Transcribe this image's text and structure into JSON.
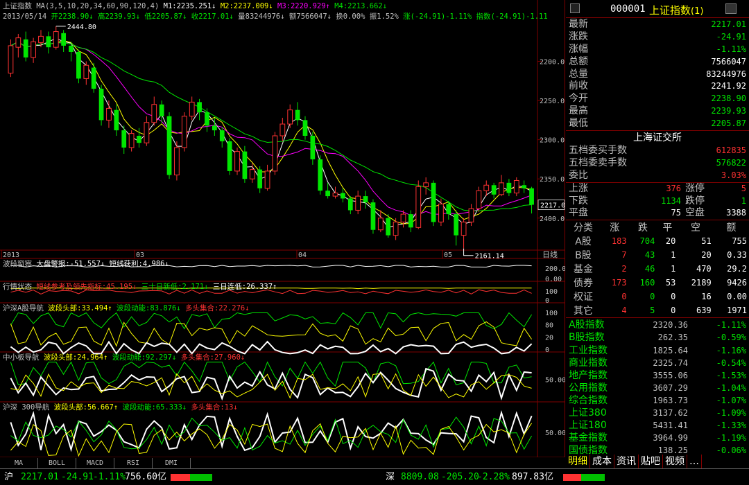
{
  "header": {
    "line1_parts": [
      {
        "text": "上证指数",
        "color": "#c0c0c0"
      },
      {
        "text": " MA(3,5,10,20,34,60,90,120,4)",
        "color": "#c0c0c0"
      },
      {
        "text": " M1:2235.251↓",
        "color": "#ffffff"
      },
      {
        "text": " M2:2237.009↓",
        "color": "#ffff00"
      },
      {
        "text": " M3:2220.929↑",
        "color": "#ff00ff"
      },
      {
        "text": " M4:2213.662↓",
        "color": "#00e600"
      }
    ],
    "line2_parts": [
      {
        "text": "2013/05/14",
        "color": "#c0c0c0"
      },
      {
        "text": " 开2238.90↓",
        "color": "#00e600"
      },
      {
        "text": " 高2239.93↓",
        "color": "#00e600"
      },
      {
        "text": " 低2205.87↓",
        "color": "#00e600"
      },
      {
        "text": " 收2217.01↓",
        "color": "#00e600"
      },
      {
        "text": " 量83244976↓",
        "color": "#c0c0c0"
      },
      {
        "text": " 额7566047↓",
        "color": "#c0c0c0"
      },
      {
        "text": " 换0.00%",
        "color": "#c0c0c0"
      },
      {
        "text": " 振1.52%",
        "color": "#c0c0c0"
      },
      {
        "text": " 涨(-24.91)-1.11%",
        "color": "#00e600"
      },
      {
        "text": " 指数(-24.91)-1.11",
        "color": "#00e600"
      }
    ],
    "high_label": "2444.80",
    "low_label": "2161.14",
    "price_tag": "2217.01"
  },
  "axis": {
    "y_ticks": [
      "2400.0",
      "2350.0",
      "2300.0",
      "2250.0",
      "2200.0"
    ],
    "months": [
      "2013",
      "03",
      "04",
      "05"
    ],
    "period": "日线"
  },
  "panels": [
    {
      "parts": [
        {
          "text": "波段窗察",
          "color": "#c0c0c0"
        },
        {
          "text": " 大盘警报:-51.557↓",
          "color": "#ffffff"
        },
        {
          "text": " 短线获利:4.986↓",
          "color": "#ffffff"
        }
      ],
      "ticks": [
        "200.00",
        "0.00"
      ]
    },
    {
      "parts": [
        {
          "text": "行情状态",
          "color": "#c0c0c0"
        },
        {
          "text": " 短线参考及领先指标:45.195↓",
          "color": "#ff3232"
        },
        {
          "text": " 三十日新低:2.171↓",
          "color": "#00e600"
        },
        {
          "text": " 三日连低:26.337↑",
          "color": "#ffffff"
        }
      ],
      "ticks": [
        "100",
        "0"
      ]
    },
    {
      "parts": [
        {
          "text": "沪深A股导航",
          "color": "#c0c0c0"
        },
        {
          "text": " 波段头部:33.494↑",
          "color": "#ffff00"
        },
        {
          "text": " 波段动能:83.876↓",
          "color": "#00e600"
        },
        {
          "text": " 多头集合:22.276↓",
          "color": "#ff3232"
        }
      ],
      "ticks": [
        "100",
        "80",
        "20",
        "0"
      ]
    },
    {
      "parts": [
        {
          "text": "中小板导航",
          "color": "#c0c0c0"
        },
        {
          "text": " 波段头部:24.964↑",
          "color": "#ffff00"
        },
        {
          "text": " 波段动能:92.297↓",
          "color": "#00e600"
        },
        {
          "text": " 多头集合:27.960↓",
          "color": "#ff3232"
        }
      ],
      "ticks": [
        "50.00"
      ]
    },
    {
      "parts": [
        {
          "text": "沪深 300导航",
          "color": "#c0c0c0"
        },
        {
          "text": " 波段头部:56.667↑",
          "color": "#ffff00"
        },
        {
          "text": " 波段动能:65.333↓",
          "color": "#00e600"
        },
        {
          "text": " 多头集合:13↓",
          "color": "#ff3232"
        }
      ],
      "ticks": [
        "50.00"
      ]
    }
  ],
  "bottom_tabs": [
    "MA",
    "BOLL",
    "MACD",
    "RSI",
    "DMI"
  ],
  "quote": {
    "code": "000001",
    "name": "上证指数",
    "suffix": "(1)",
    "rows": [
      {
        "k": "最新",
        "v": "2217.01",
        "c": "#00e600"
      },
      {
        "k": "涨跌",
        "v": "-24.91",
        "c": "#00e600"
      },
      {
        "k": "涨幅",
        "v": "-1.11%",
        "c": "#00e600"
      },
      {
        "k": "总额",
        "v": "7566047",
        "c": "#ffffff"
      },
      {
        "k": "总量",
        "v": "83244976",
        "c": "#ffffff"
      },
      {
        "k": "前收",
        "v": "2241.92",
        "c": "#ffffff"
      },
      {
        "k": "今开",
        "v": "2238.90",
        "c": "#00e600"
      },
      {
        "k": "最高",
        "v": "2239.93",
        "c": "#00e600"
      },
      {
        "k": "最低",
        "v": "2205.87",
        "c": "#00e600"
      }
    ],
    "exchange": "上海证交所",
    "order_rows": [
      {
        "k": "五档委买手数",
        "v": "612835",
        "c": "#ff3232"
      },
      {
        "k": "五档委卖手数",
        "v": "576822",
        "c": "#00e600"
      },
      {
        "k": "委比",
        "v": "3.03%",
        "c": "#ff3232"
      }
    ],
    "updown": [
      {
        "k1": "上涨",
        "v1": "376",
        "c1": "#ff3232",
        "k2": "涨停",
        "v2": "5",
        "c2": "#ff3232"
      },
      {
        "k1": "下跌",
        "v1": "1134",
        "c1": "#00e600",
        "k2": "跌停",
        "v2": "1",
        "c2": "#00e600"
      },
      {
        "k1": "平盘",
        "v1": "75",
        "c1": "#ffffff",
        "k2": "空盘",
        "v2": "3388",
        "c2": "#ffffff"
      }
    ]
  },
  "market_table": {
    "headers": [
      "分类",
      "涨",
      "跌",
      "平",
      "空",
      "额"
    ],
    "rows": [
      {
        "name": "A股",
        "up": "183",
        "down": "704",
        "flat": "20",
        "empty": "51",
        "amt": "755"
      },
      {
        "name": "B股",
        "up": "7",
        "down": "43",
        "flat": "1",
        "empty": "20",
        "amt": "0.33"
      },
      {
        "name": "基金",
        "up": "2",
        "down": "46",
        "flat": "1",
        "empty": "470",
        "amt": "29.2"
      },
      {
        "name": "债券",
        "up": "173",
        "down": "160",
        "flat": "53",
        "empty": "2189",
        "amt": "9426"
      },
      {
        "name": "权证",
        "up": "0",
        "down": "0",
        "flat": "0",
        "empty": "16",
        "amt": "0.00"
      },
      {
        "name": "其它",
        "up": "4",
        "down": "5",
        "flat": "0",
        "empty": "639",
        "amt": "1971"
      }
    ]
  },
  "indices": [
    {
      "name": "A股指数",
      "price": "2320.36",
      "chg": "-1.11%"
    },
    {
      "name": "B股指数",
      "price": "262.35",
      "chg": "-0.59%"
    },
    {
      "name": "工业指数",
      "price": "1825.64",
      "chg": "-1.16%"
    },
    {
      "name": "商业指数",
      "price": "2325.74",
      "chg": "-0.54%"
    },
    {
      "name": "地产指数",
      "price": "3555.06",
      "chg": "-1.53%"
    },
    {
      "name": "公用指数",
      "price": "3607.29",
      "chg": "-1.04%"
    },
    {
      "name": "综合指数",
      "price": "1963.73",
      "chg": "-1.07%"
    },
    {
      "name": "上证380",
      "price": "3137.62",
      "chg": "-1.09%"
    },
    {
      "name": "上证180",
      "price": "5431.41",
      "chg": "-1.33%"
    },
    {
      "name": "基金指数",
      "price": "3964.99",
      "chg": "-1.19%"
    },
    {
      "name": "国债指数",
      "price": "138.25",
      "chg": "-0.06%"
    }
  ],
  "right_tabs": [
    "明细",
    "成本",
    "资讯",
    "贴吧",
    "视频",
    "…"
  ],
  "status": {
    "sh_label": "沪",
    "sh_price": "2217.01",
    "sh_chg": "-24.91",
    "sh_pct": "-1.11%",
    "sh_amt": "756.60亿",
    "sz_label": "深",
    "sz_price": "8809.08",
    "sz_chg": "-205.20",
    "sz_pct": "-2.28%",
    "sz_amt": "897.83亿"
  },
  "chart_data": {
    "type": "candlestick",
    "title": "上证指数",
    "ylim": [
      2160,
      2450
    ],
    "y_ticks": [
      2200,
      2250,
      2300,
      2350,
      2400
    ],
    "x_month_labels": [
      "2013",
      "03",
      "04",
      "05"
    ],
    "high_point": 2444.8,
    "low_point": 2161.14,
    "last_close": 2217.01,
    "candles": [
      {
        "o": 2385,
        "c": 2420,
        "h": 2428,
        "l": 2380
      },
      {
        "o": 2418,
        "c": 2430,
        "h": 2435,
        "l": 2405
      },
      {
        "o": 2428,
        "c": 2405,
        "h": 2438,
        "l": 2400
      },
      {
        "o": 2405,
        "c": 2425,
        "h": 2430,
        "l": 2398
      },
      {
        "o": 2424,
        "c": 2432,
        "h": 2440,
        "l": 2418
      },
      {
        "o": 2432,
        "c": 2418,
        "h": 2438,
        "l": 2410
      },
      {
        "o": 2418,
        "c": 2438,
        "h": 2444.8,
        "l": 2415
      },
      {
        "o": 2436,
        "c": 2420,
        "h": 2440,
        "l": 2412
      },
      {
        "o": 2420,
        "c": 2412,
        "h": 2425,
        "l": 2400
      },
      {
        "o": 2412,
        "c": 2378,
        "h": 2415,
        "l": 2372
      },
      {
        "o": 2378,
        "c": 2395,
        "h": 2400,
        "l": 2370
      },
      {
        "o": 2392,
        "c": 2365,
        "h": 2398,
        "l": 2360
      },
      {
        "o": 2365,
        "c": 2325,
        "h": 2370,
        "l": 2318
      },
      {
        "o": 2325,
        "c": 2340,
        "h": 2350,
        "l": 2315
      },
      {
        "o": 2338,
        "c": 2312,
        "h": 2345,
        "l": 2305
      },
      {
        "o": 2312,
        "c": 2290,
        "h": 2318,
        "l": 2282
      },
      {
        "o": 2290,
        "c": 2308,
        "h": 2312,
        "l": 2285
      },
      {
        "o": 2305,
        "c": 2296,
        "h": 2315,
        "l": 2290
      },
      {
        "o": 2296,
        "c": 2322,
        "h": 2330,
        "l": 2292
      },
      {
        "o": 2322,
        "c": 2345,
        "h": 2355,
        "l": 2318
      },
      {
        "o": 2345,
        "c": 2330,
        "h": 2350,
        "l": 2322
      },
      {
        "o": 2330,
        "c": 2255,
        "h": 2335,
        "l": 2250
      },
      {
        "o": 2255,
        "c": 2290,
        "h": 2298,
        "l": 2248
      },
      {
        "o": 2290,
        "c": 2330,
        "h": 2335,
        "l": 2285
      },
      {
        "o": 2330,
        "c": 2348,
        "h": 2355,
        "l": 2325
      },
      {
        "o": 2348,
        "c": 2335,
        "h": 2352,
        "l": 2325
      },
      {
        "o": 2335,
        "c": 2318,
        "h": 2340,
        "l": 2310
      },
      {
        "o": 2318,
        "c": 2312,
        "h": 2328,
        "l": 2305
      },
      {
        "o": 2312,
        "c": 2298,
        "h": 2316,
        "l": 2290
      },
      {
        "o": 2298,
        "c": 2260,
        "h": 2302,
        "l": 2255
      },
      {
        "o": 2260,
        "c": 2285,
        "h": 2290,
        "l": 2255
      },
      {
        "o": 2285,
        "c": 2250,
        "h": 2292,
        "l": 2245
      },
      {
        "o": 2250,
        "c": 2262,
        "h": 2270,
        "l": 2245
      },
      {
        "o": 2262,
        "c": 2238,
        "h": 2266,
        "l": 2232
      },
      {
        "o": 2238,
        "c": 2260,
        "h": 2268,
        "l": 2235
      },
      {
        "o": 2260,
        "c": 2305,
        "h": 2310,
        "l": 2255
      },
      {
        "o": 2305,
        "c": 2320,
        "h": 2328,
        "l": 2298
      },
      {
        "o": 2320,
        "c": 2338,
        "h": 2345,
        "l": 2315
      },
      {
        "o": 2338,
        "c": 2325,
        "h": 2348,
        "l": 2318
      },
      {
        "o": 2325,
        "c": 2305,
        "h": 2330,
        "l": 2300
      },
      {
        "o": 2305,
        "c": 2275,
        "h": 2310,
        "l": 2268
      },
      {
        "o": 2275,
        "c": 2235,
        "h": 2280,
        "l": 2230
      },
      {
        "o": 2235,
        "c": 2228,
        "h": 2245,
        "l": 2225
      },
      {
        "o": 2228,
        "c": 2232,
        "h": 2240,
        "l": 2225
      },
      {
        "o": 2232,
        "c": 2225,
        "h": 2238,
        "l": 2220
      },
      {
        "o": 2225,
        "c": 2210,
        "h": 2228,
        "l": 2205
      },
      {
        "o": 2210,
        "c": 2228,
        "h": 2235,
        "l": 2205
      },
      {
        "o": 2228,
        "c": 2220,
        "h": 2235,
        "l": 2212
      },
      {
        "o": 2220,
        "c": 2185,
        "h": 2224,
        "l": 2180
      },
      {
        "o": 2185,
        "c": 2200,
        "h": 2210,
        "l": 2182
      },
      {
        "o": 2200,
        "c": 2178,
        "h": 2205,
        "l": 2175
      },
      {
        "o": 2178,
        "c": 2195,
        "h": 2200,
        "l": 2172
      },
      {
        "o": 2195,
        "c": 2205,
        "h": 2210,
        "l": 2188
      },
      {
        "o": 2205,
        "c": 2188,
        "h": 2210,
        "l": 2182
      },
      {
        "o": 2188,
        "c": 2240,
        "h": 2248,
        "l": 2186
      },
      {
        "o": 2240,
        "c": 2245,
        "h": 2252,
        "l": 2230
      },
      {
        "o": 2245,
        "c": 2195,
        "h": 2248,
        "l": 2190
      },
      {
        "o": 2195,
        "c": 2218,
        "h": 2225,
        "l": 2190
      },
      {
        "o": 2218,
        "c": 2205,
        "h": 2222,
        "l": 2198
      },
      {
        "o": 2205,
        "c": 2178,
        "h": 2210,
        "l": 2165
      },
      {
        "o": 2178,
        "c": 2195,
        "h": 2200,
        "l": 2161.14
      },
      {
        "o": 2195,
        "c": 2212,
        "h": 2218,
        "l": 2190
      },
      {
        "o": 2212,
        "c": 2235,
        "h": 2240,
        "l": 2208
      },
      {
        "o": 2235,
        "c": 2242,
        "h": 2248,
        "l": 2228
      },
      {
        "o": 2242,
        "c": 2230,
        "h": 2245,
        "l": 2225
      },
      {
        "o": 2230,
        "c": 2245,
        "h": 2255,
        "l": 2228
      },
      {
        "o": 2245,
        "c": 2232,
        "h": 2250,
        "l": 2228
      },
      {
        "o": 2232,
        "c": 2248,
        "h": 2252,
        "l": 2228
      },
      {
        "o": 2242,
        "c": 2238,
        "h": 2248,
        "l": 2232
      },
      {
        "o": 2238,
        "c": 2217.01,
        "h": 2239.93,
        "l": 2205.87
      }
    ],
    "ma_series": [
      {
        "name": "M1",
        "color": "#ffffff",
        "period": 3
      },
      {
        "name": "M2",
        "color": "#ffff00",
        "period": 5
      },
      {
        "name": "M3",
        "color": "#ff00ff",
        "period": 10
      },
      {
        "name": "M4",
        "color": "#00e600",
        "period": 20
      }
    ]
  },
  "colors": {
    "up": "#ff3232",
    "down": "#00e600",
    "border": "#800000",
    "grid": "#800000"
  }
}
